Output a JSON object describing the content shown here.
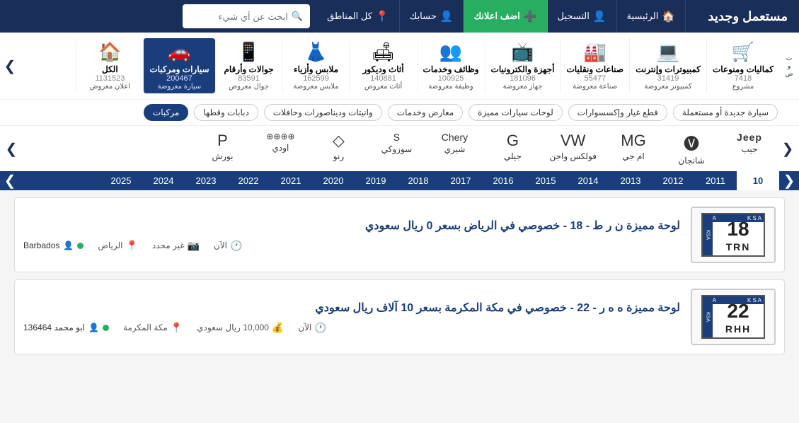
{
  "brand": {
    "name": "مستعمل وجديد",
    "name_old": "مستعمل"
  },
  "nav": {
    "items": [
      {
        "id": "home",
        "label": "الرئيسية",
        "icon": "🏠"
      },
      {
        "id": "register",
        "label": "التسجيل",
        "icon": "👤"
      },
      {
        "id": "add",
        "label": "اضف اعلانك",
        "icon": "➕",
        "highlight": true
      },
      {
        "id": "account",
        "label": "حسابك",
        "icon": "👤"
      },
      {
        "id": "regions",
        "label": "كل المناطق",
        "icon": "📍"
      }
    ],
    "search_placeholder": "ابحث عن أي شيء"
  },
  "categories": [
    {
      "id": "all",
      "icon": "🏠",
      "name": "الكل",
      "count": "1131523",
      "sub": "اعلان معروض"
    },
    {
      "id": "cars",
      "icon": "🚗",
      "name": "سيارات ومركبات",
      "count": "200467",
      "sub": "سيارة معروضة",
      "active": true
    },
    {
      "id": "mobiles",
      "icon": "📱",
      "name": "جوالات وأرقام",
      "count": "83591",
      "sub": "جوال معروض"
    },
    {
      "id": "fashion",
      "icon": "👗",
      "name": "ملابس وأزياء",
      "count": "162599",
      "sub": "ملابس معروضة"
    },
    {
      "id": "furniture",
      "icon": "🛋",
      "name": "أثاث وديكور",
      "count": "140881",
      "sub": "أثاث معروض"
    },
    {
      "id": "jobs",
      "icon": "👥",
      "name": "وظائف وخدمات",
      "count": "100925",
      "sub": "وظيفة معروضة"
    },
    {
      "id": "electronics",
      "icon": "📺",
      "name": "أجهزة والكترونيات",
      "count": "181096",
      "sub": "جهاز معروضة"
    },
    {
      "id": "industry",
      "icon": "🏭",
      "name": "صناعات ونقليات",
      "count": "55477",
      "sub": "صناعة معروضة"
    },
    {
      "id": "computers",
      "icon": "💻",
      "name": "كمبيوترات وإنترنت",
      "count": "31419",
      "sub": "كمبيوتر معروضة"
    },
    {
      "id": "accessories",
      "icon": "🛒",
      "name": "كماليات ومنوعات",
      "count": "7418",
      "sub": "مشروع"
    }
  ],
  "left_promo": {
    "lines": [
      "ت",
      "و",
      "ص"
    ]
  },
  "filter_tabs": [
    {
      "label": "سيارة جديدة أو مستعملة",
      "active": false
    },
    {
      "label": "قطع غيار وإكسسوارات",
      "active": false
    },
    {
      "label": "لوحات سيارات مميزة",
      "active": false
    },
    {
      "label": "معارض وخدمات",
      "active": false
    },
    {
      "label": "وانيتات وديناصورات وحافلات",
      "active": false
    },
    {
      "label": "دبابات وقطها",
      "active": false
    },
    {
      "label": "مركبات",
      "active": true
    }
  ],
  "brands": [
    {
      "id": "jeep",
      "logo": "𝐉𝐞𝐞𝐩",
      "label": "جيب"
    },
    {
      "id": "changan",
      "logo": "Ⓥ",
      "label": "شانجان"
    },
    {
      "id": "mg",
      "logo": "🅜🅖",
      "label": "ام جي"
    },
    {
      "id": "volkswagen",
      "logo": "⓪",
      "label": "فولكس واجن"
    },
    {
      "id": "geely",
      "logo": "G",
      "label": "جيلي"
    },
    {
      "id": "chery",
      "logo": "☆",
      "label": "شيري"
    },
    {
      "id": "suzuki",
      "logo": "S",
      "label": "سوزوكي"
    },
    {
      "id": "renault",
      "logo": "◇",
      "label": "رنو"
    },
    {
      "id": "audi",
      "logo": "⊕",
      "label": "اودي"
    },
    {
      "id": "porsche",
      "logo": "P",
      "label": "بورش"
    }
  ],
  "years": [
    {
      "value": "10",
      "active": true
    },
    {
      "value": "2011"
    },
    {
      "value": "2012"
    },
    {
      "value": "2013"
    },
    {
      "value": "2014"
    },
    {
      "value": "2015"
    },
    {
      "value": "2016"
    },
    {
      "value": "2017"
    },
    {
      "value": "2018"
    },
    {
      "value": "2019"
    },
    {
      "value": "2020"
    },
    {
      "value": "2021"
    },
    {
      "value": "2022"
    },
    {
      "value": "2023"
    },
    {
      "value": "2024"
    },
    {
      "value": "2025"
    }
  ],
  "listings": [
    {
      "id": "listing-1",
      "title": "لوحة مميزة ن ر ط - 18 - خصوصي في الرياض بسعر 0 ريال سعودي",
      "plate_num": "18",
      "plate_letters": "TRN",
      "time": "الآن",
      "condition": "غير محدد",
      "location": "الرياض",
      "user": "Barbados",
      "price": null
    },
    {
      "id": "listing-2",
      "title": "لوحة مميزة ه ه ر - 22 - خصوصي في مكة المكرمة بسعر 10 آلاف ريال سعودي",
      "plate_num": "22",
      "plate_letters": "RHH",
      "time": "الآن",
      "condition": null,
      "location": "مكة المكرمة",
      "user": "ابو محمد 136464",
      "price": "10,000 ريال سعودي"
    }
  ]
}
